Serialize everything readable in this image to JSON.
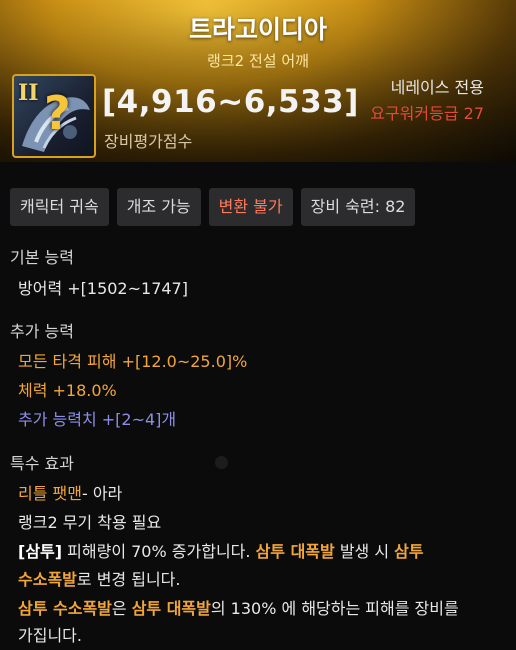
{
  "item": {
    "name": "트라고이디아",
    "subtitle": "랭크2 전설 어깨",
    "rank_badge": "II",
    "icon": "shoulder-armor-icon",
    "unknown_mark": "?",
    "score_range": "[4,916~6,533]",
    "score_label": "장비평가점수",
    "class_req": "네레이스 전용",
    "level_req": "요구워커등급 27"
  },
  "tags": [
    "캐릭터 귀속",
    "개조 가능",
    "변환 불가",
    "장비 숙련: 82"
  ],
  "basic": {
    "title": "기본 능력",
    "line": "방어력  +[1502~1747]"
  },
  "extra": {
    "title": "추가 능력",
    "line1": "모든 타격 피해  +[12.0~25.0]%",
    "line2": "체력  +18.0%",
    "line3": "추가 능력치 +[2~4]개"
  },
  "special": {
    "title": "특수 효과",
    "source_bold": "리틀 팻맨",
    "source_rest": "- 아라",
    "requirement": "랭크2 무기 착용 필요",
    "p1_a": "[삼투]",
    "p1_b": " 피해량이 70% 증가합니다. ",
    "p1_c": "삼투 대폭발",
    "p1_d": " 발생 시 ",
    "p1_e": "삼투",
    "p2_a": "수소폭발",
    "p2_b": "로 변경 됩니다.",
    "p3_a": "삼투 수소폭발",
    "p3_b": "은 ",
    "p3_c": "삼투 대폭발",
    "p3_d": "의 130% 에 해당하는 피해를 장비를",
    "p4": "가집니다."
  },
  "colors": {
    "header_gold": "#c98f14",
    "highlight_orange": "#f2a63a",
    "requirement_red": "#e04b3a",
    "blue_stat": "#8e8ee8"
  }
}
